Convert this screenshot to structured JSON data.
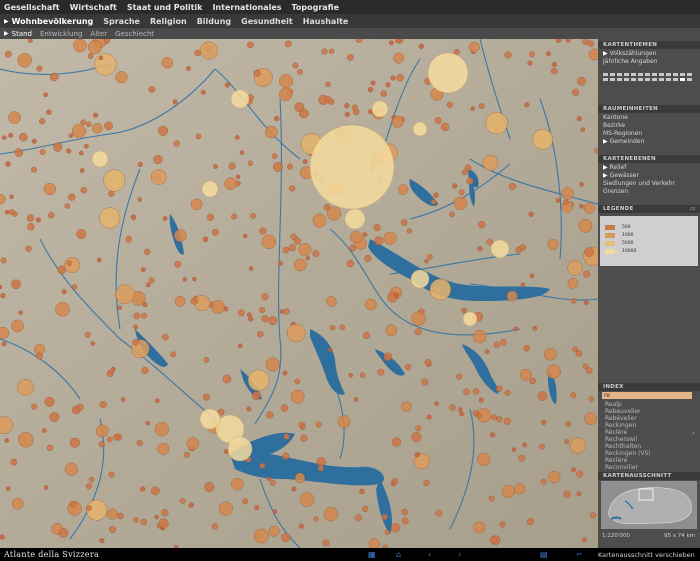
{
  "menu_primary": [
    "Gesellschaft",
    "Wirtschaft",
    "Staat und Politik",
    "Internationales",
    "Topografie"
  ],
  "menu_secondary": [
    "Wohnbevölkerung",
    "Sprache",
    "Religion",
    "Bildung",
    "Gesundheit",
    "Haushalte"
  ],
  "menu_tertiary": [
    "Stand",
    "Entwicklung",
    "Alter",
    "Geschlecht"
  ],
  "panel": {
    "kartenthemen_title": "KARTENTHEMEN",
    "kartenthemen_items": [
      "Volkszählungen",
      "Jährliche Angaben"
    ],
    "raumeinheiten_title": "RAUMEINHEITEN",
    "raumeinheiten_items": [
      "Kantone",
      "Bezirke",
      "MS-Regionen",
      "Gemeinden"
    ],
    "kartenebenen_title": "KARTENEBENEN",
    "kartenebenen_items": [
      "Relief",
      "Gewässer",
      "Siedlungen und Verkehr",
      "Grenzen"
    ],
    "legende_title": "LEGENDE",
    "legend": {
      "items": [
        "500",
        "1000",
        "5000",
        "10000"
      ],
      "colors": [
        "#c97a4a",
        "#d69a5a",
        "#e4bd78",
        "#f0dc9c"
      ]
    },
    "index_title": "INDEX",
    "search_value": "re",
    "index_items": [
      "Realp",
      "Rebeuvelier",
      "Rebévelier",
      "Reckingen",
      "Réclère",
      "Recherswil",
      "Rechthalten",
      "Reckingen (VS)",
      "Réclère",
      "Reconvilier"
    ],
    "kartenausschnitt_title": "KARTENAUSSCHNITT",
    "scale_text": "1:220'000",
    "extent_text": "95 x 74 km"
  },
  "status": {
    "brand": "Atlante della Svizzera",
    "text": "Kartenausschnitt verschieben"
  },
  "colors": {
    "lake": "#2e6f9e",
    "terrain": "#b7ae9e",
    "bubble_small": "#c9643c",
    "bubble_large": "#f4dc9e"
  }
}
